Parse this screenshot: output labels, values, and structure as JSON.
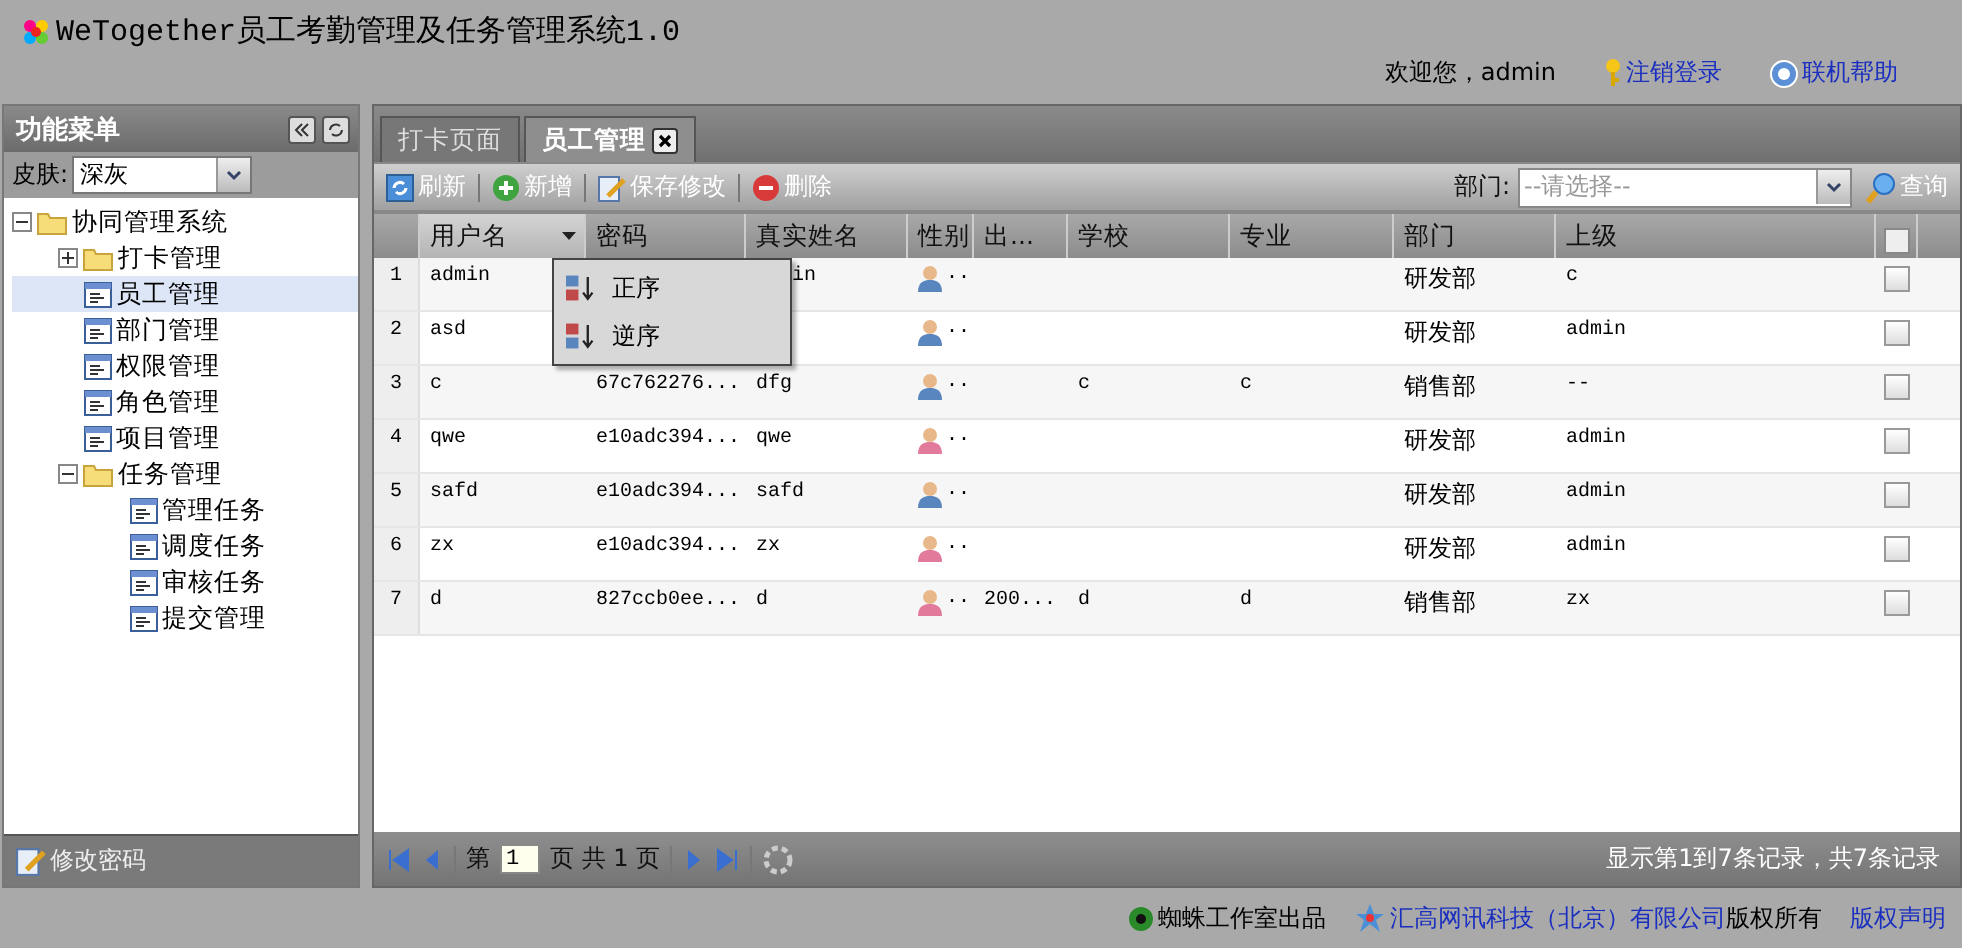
{
  "header": {
    "title": "WeTogether员工考勤管理及任务管理系统1.0",
    "welcome": "欢迎您，admin",
    "links": [
      {
        "kind": "key",
        "label": "注销登录"
      },
      {
        "kind": "help",
        "label": "联机帮助"
      }
    ]
  },
  "sidebar": {
    "title": "功能菜单",
    "skin_label": "皮肤:",
    "skin_value": "深灰",
    "tree": [
      {
        "label": "协同管理系统",
        "kind": "folder",
        "expanded": true,
        "selected": false,
        "children": [
          {
            "label": "打卡管理",
            "kind": "folder",
            "expanded": false,
            "selected": false
          },
          {
            "label": "员工管理",
            "kind": "page",
            "selected": true
          },
          {
            "label": "部门管理",
            "kind": "page",
            "selected": false
          },
          {
            "label": "权限管理",
            "kind": "page",
            "selected": false
          },
          {
            "label": "角色管理",
            "kind": "page",
            "selected": false
          },
          {
            "label": "项目管理",
            "kind": "page",
            "selected": false
          },
          {
            "label": "任务管理",
            "kind": "folder",
            "expanded": true,
            "selected": false,
            "children": [
              {
                "label": "管理任务",
                "kind": "page",
                "selected": false
              },
              {
                "label": "调度任务",
                "kind": "page",
                "selected": false
              },
              {
                "label": "审核任务",
                "kind": "page",
                "selected": false
              },
              {
                "label": "提交管理",
                "kind": "page",
                "selected": false
              }
            ]
          }
        ]
      }
    ],
    "footer_link": "修改密码"
  },
  "tabs": [
    {
      "label": "打卡页面",
      "selected": false,
      "closable": false
    },
    {
      "label": "员工管理",
      "selected": true,
      "closable": true
    }
  ],
  "toolbar": {
    "buttons": [
      {
        "kind": "refresh",
        "label": "刷新"
      },
      {
        "kind": "add",
        "label": "新增"
      },
      {
        "kind": "save",
        "label": "保存修改"
      },
      {
        "kind": "delete",
        "label": "删除"
      }
    ],
    "filter_label": "部门:",
    "filter_placeholder": "--请选择--",
    "search_label": "查询"
  },
  "table": {
    "columns": [
      {
        "label": "用户名",
        "menu": true
      },
      {
        "label": "密码",
        "menu": false
      },
      {
        "label": "真实姓名",
        "menu": false
      },
      {
        "label": "性别",
        "menu": false
      },
      {
        "label": "出...",
        "menu": false
      },
      {
        "label": "学校",
        "menu": false
      },
      {
        "label": "专业",
        "menu": false
      },
      {
        "label": "部门",
        "menu": false
      },
      {
        "label": "上级",
        "menu": false
      }
    ],
    "all_checked": false,
    "rows": [
      {
        "num": "1",
        "user": "admin",
        "real_name": "in",
        "real_name_cut": true,
        "gender": {
          "kind": "male",
          "text": ".."
        },
        "dept": "研发部",
        "superior": "c",
        "checked": false
      },
      {
        "num": "2",
        "user": "asd",
        "gender": {
          "kind": "male",
          "text": ".."
        },
        "dept": "研发部",
        "superior": "admin",
        "checked": false
      },
      {
        "num": "3",
        "user": "c",
        "password": "67c762276...",
        "real_name": "dfg",
        "gender": {
          "kind": "male",
          "text": ".."
        },
        "school": "c",
        "major": "c",
        "dept": "销售部",
        "superior": "--",
        "checked": false
      },
      {
        "num": "4",
        "user": "qwe",
        "password": "e10adc394...",
        "real_name": "qwe",
        "gender": {
          "kind": "female",
          "text": ".."
        },
        "dept": "研发部",
        "superior": "admin",
        "checked": false
      },
      {
        "num": "5",
        "user": "safd",
        "password": "e10adc394...",
        "real_name": "safd",
        "gender": {
          "kind": "male",
          "text": ".."
        },
        "dept": "研发部",
        "superior": "admin",
        "checked": false
      },
      {
        "num": "6",
        "user": "zx",
        "password": "e10adc394...",
        "real_name": "zx",
        "gender": {
          "kind": "female",
          "text": ".."
        },
        "dept": "研发部",
        "superior": "admin",
        "checked": false
      },
      {
        "num": "7",
        "user": "d",
        "password": "827ccb0ee...",
        "real_name": "d",
        "gender": {
          "kind": "female",
          "text": ".."
        },
        "birth": "200...",
        "school": "d",
        "major": "d",
        "dept": "销售部",
        "superior": "zx",
        "checked": false
      }
    ],
    "sort_menu": [
      {
        "kind": "asc",
        "label": "正序"
      },
      {
        "kind": "desc",
        "label": "逆序"
      }
    ]
  },
  "pager": {
    "page_prefix": "第",
    "page_value": "1",
    "page_suffix": "页 共 1 页",
    "summary": "显示第1到7条记录，共7条记录"
  },
  "footer": {
    "studio": "蜘蛛工作室出品",
    "company": "汇高网讯科技（北京）有限公司",
    "rights": "版权所有",
    "notice": "版权声明"
  }
}
